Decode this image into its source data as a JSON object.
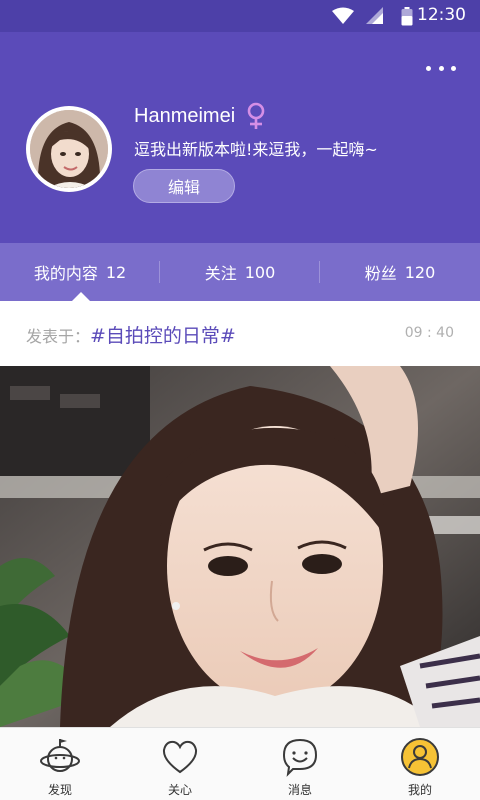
{
  "status_bar": {
    "time": "12:30"
  },
  "profile": {
    "username": "Hanmeimei",
    "gender_icon": "female-symbol-icon",
    "signature": "逗我出新版本啦!来逗我，一起嗨~",
    "edit_label": "编辑",
    "accent_color": "#5b4bb9"
  },
  "stats": {
    "tabs": [
      {
        "label": "我的内容",
        "count": "12"
      },
      {
        "label": "关注",
        "count": "100"
      },
      {
        "label": "粉丝",
        "count": "120"
      }
    ]
  },
  "post": {
    "prefix": "发表于：",
    "topic": "#自拍控的日常#",
    "time": "09 : 40"
  },
  "bottom_nav": {
    "items": [
      {
        "label": "发现",
        "icon": "planet-icon"
      },
      {
        "label": "关心",
        "icon": "heart-icon"
      },
      {
        "label": "消息",
        "icon": "chat-face-icon"
      },
      {
        "label": "我的",
        "icon": "user-icon"
      }
    ]
  }
}
